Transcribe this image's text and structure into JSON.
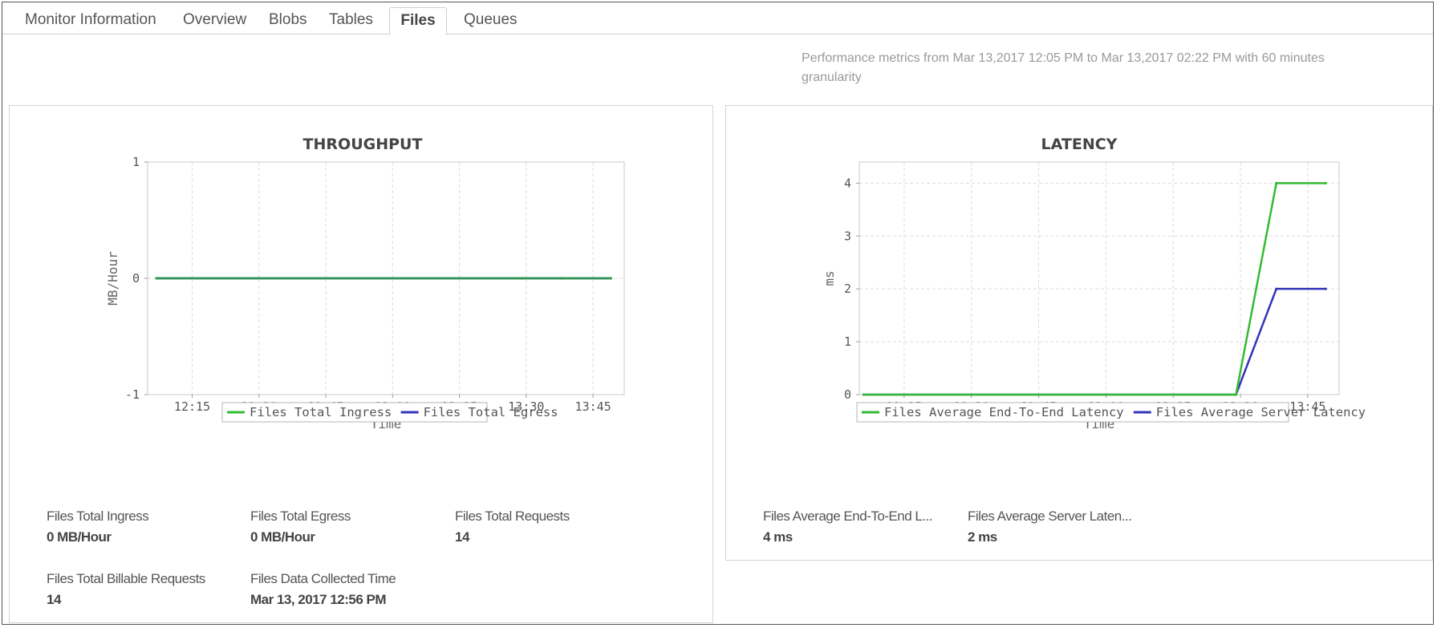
{
  "tabs": [
    {
      "label": "Monitor Information",
      "active": false
    },
    {
      "label": "Overview",
      "active": false
    },
    {
      "label": "Blobs",
      "active": false
    },
    {
      "label": "Tables",
      "active": false
    },
    {
      "label": "Files",
      "active": true
    },
    {
      "label": "Queues",
      "active": false
    }
  ],
  "performance_text": "Performance metrics from Mar 13,2017 12:05 PM to Mar 13,2017 02:22 PM with 60 minutes granularity",
  "chart_data": [
    {
      "type": "line",
      "title": "THROUGHPUT",
      "xlabel": "Time",
      "ylabel": "MB/Hour",
      "x_ticks": [
        "12:15",
        "12:30",
        "12:45",
        "13:00",
        "13:15",
        "13:30",
        "13:45"
      ],
      "y_ticks": [
        -1,
        0,
        1
      ],
      "ylim": [
        -1,
        1
      ],
      "grid": true,
      "legend_position": "bottom",
      "series": [
        {
          "name": "Files Total Ingress",
          "color": "#33bb33",
          "points": [
            [
              "12:07",
              0
            ],
            [
              "13:29",
              0
            ],
            [
              "13:38",
              0
            ],
            [
              "13:49",
              0
            ]
          ]
        },
        {
          "name": "Files Total Egress",
          "color": "#3333bb",
          "points": [
            [
              "12:07",
              0
            ],
            [
              "13:29",
              0
            ],
            [
              "13:38",
              0
            ],
            [
              "13:49",
              0
            ]
          ]
        }
      ]
    },
    {
      "type": "line",
      "title": "LATENCY",
      "xlabel": "Time",
      "ylabel": "ms",
      "x_ticks": [
        "12:15",
        "12:30",
        "12:45",
        "13:00",
        "13:15",
        "13:30",
        "13:45"
      ],
      "y_ticks": [
        0,
        1,
        2,
        3,
        4
      ],
      "ylim": [
        0,
        4.4
      ],
      "grid": true,
      "legend_position": "bottom",
      "series": [
        {
          "name": "Files Average End-To-End Latency",
          "color": "#33bb33",
          "points": [
            [
              "12:06",
              0
            ],
            [
              "13:29",
              0
            ],
            [
              "13:38",
              4
            ],
            [
              "13:49",
              4
            ]
          ]
        },
        {
          "name": "Files Average Server Latency",
          "color": "#3333bb",
          "points": [
            [
              "12:06",
              0
            ],
            [
              "13:29",
              0
            ],
            [
              "13:38",
              2
            ],
            [
              "13:49",
              2
            ]
          ]
        }
      ]
    }
  ],
  "metrics_left": [
    {
      "label": "Files Total Ingress",
      "value": "0 MB/Hour"
    },
    {
      "label": "Files Total Egress",
      "value": "0 MB/Hour"
    },
    {
      "label": "Files Total Requests",
      "value": "14"
    },
    {
      "label": "Files Total Billable Requests",
      "value": "14"
    },
    {
      "label": "Files Data Collected Time",
      "value": "Mar 13, 2017 12:56 PM"
    }
  ],
  "metrics_right": [
    {
      "label": "Files Average End-To-End L...",
      "value": "4 ms"
    },
    {
      "label": "Files Average Server Laten...",
      "value": "2 ms"
    }
  ]
}
